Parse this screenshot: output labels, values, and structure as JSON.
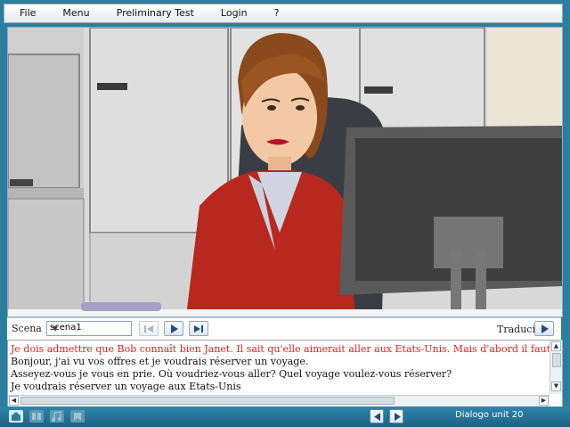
{
  "menu": {
    "items": [
      "File",
      "Menu",
      "Preliminary Test",
      "Login",
      "?"
    ]
  },
  "controls": {
    "scena_label": "Scena",
    "scena_value": "scena1",
    "traduci_label": "Traduci"
  },
  "dialogue": {
    "lines": [
      {
        "text": "Je dois admettre que Bob connaît bien Janet. Il sait qu'elle aimerait aller aux Etats-Unis. Mais d'abord il faut aller dans une agence et a",
        "color": "#e0231c"
      },
      {
        "text": "Bonjour, j'ai vu vos offres et je voudrais réserver un voyage.",
        "color": "#111111"
      },
      {
        "text": "Asseyez-vous je vous en prie. Où voudriez-vous aller? Quel voyage voulez-vous réserver?",
        "color": "#111111"
      },
      {
        "text": "Je voudrais réserver un voyage aux Etats-Unis",
        "color": "#111111"
      }
    ]
  },
  "footer": {
    "unit_label": "Dialogo unit 20"
  },
  "colors": {
    "accent": "#2a7ea0",
    "highlight_text": "#e0231c"
  }
}
